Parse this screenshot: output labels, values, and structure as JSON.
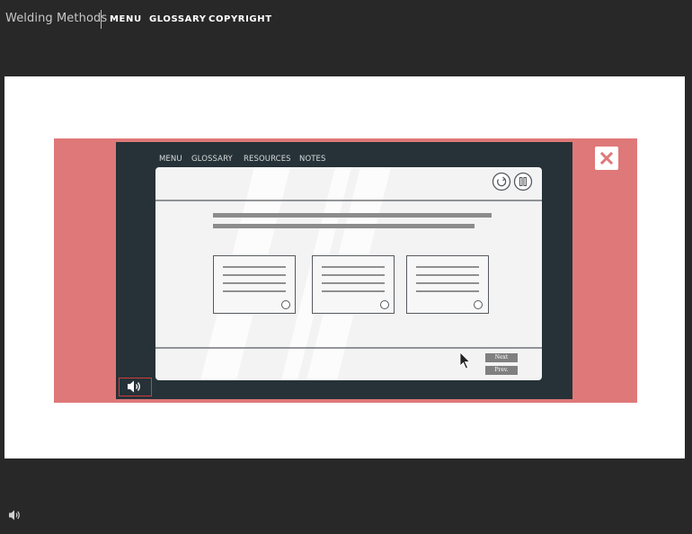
{
  "app": {
    "title": "Welding Methods"
  },
  "nav": {
    "items": [
      {
        "label": "MENU"
      },
      {
        "label": "GLOSSARY"
      },
      {
        "label": "COPYRIGHT"
      }
    ]
  },
  "video": {
    "nav": [
      "MENU",
      "GLOSSARY",
      "RESOURCES",
      "NOTES"
    ],
    "next_label": "Next",
    "prev_label": "Prev."
  },
  "icons": {
    "close": "close-icon",
    "speaker": "speaker-icon",
    "reload": "reload-icon",
    "pause": "pause-icon",
    "cursor": "cursor-icon"
  },
  "colors": {
    "background": "#282828",
    "stage": "#ffffff",
    "accent_pink": "#df7878",
    "video_bg": "#263238",
    "card_bg": "#f3f3f4",
    "audio_border": "#d23b3b"
  }
}
